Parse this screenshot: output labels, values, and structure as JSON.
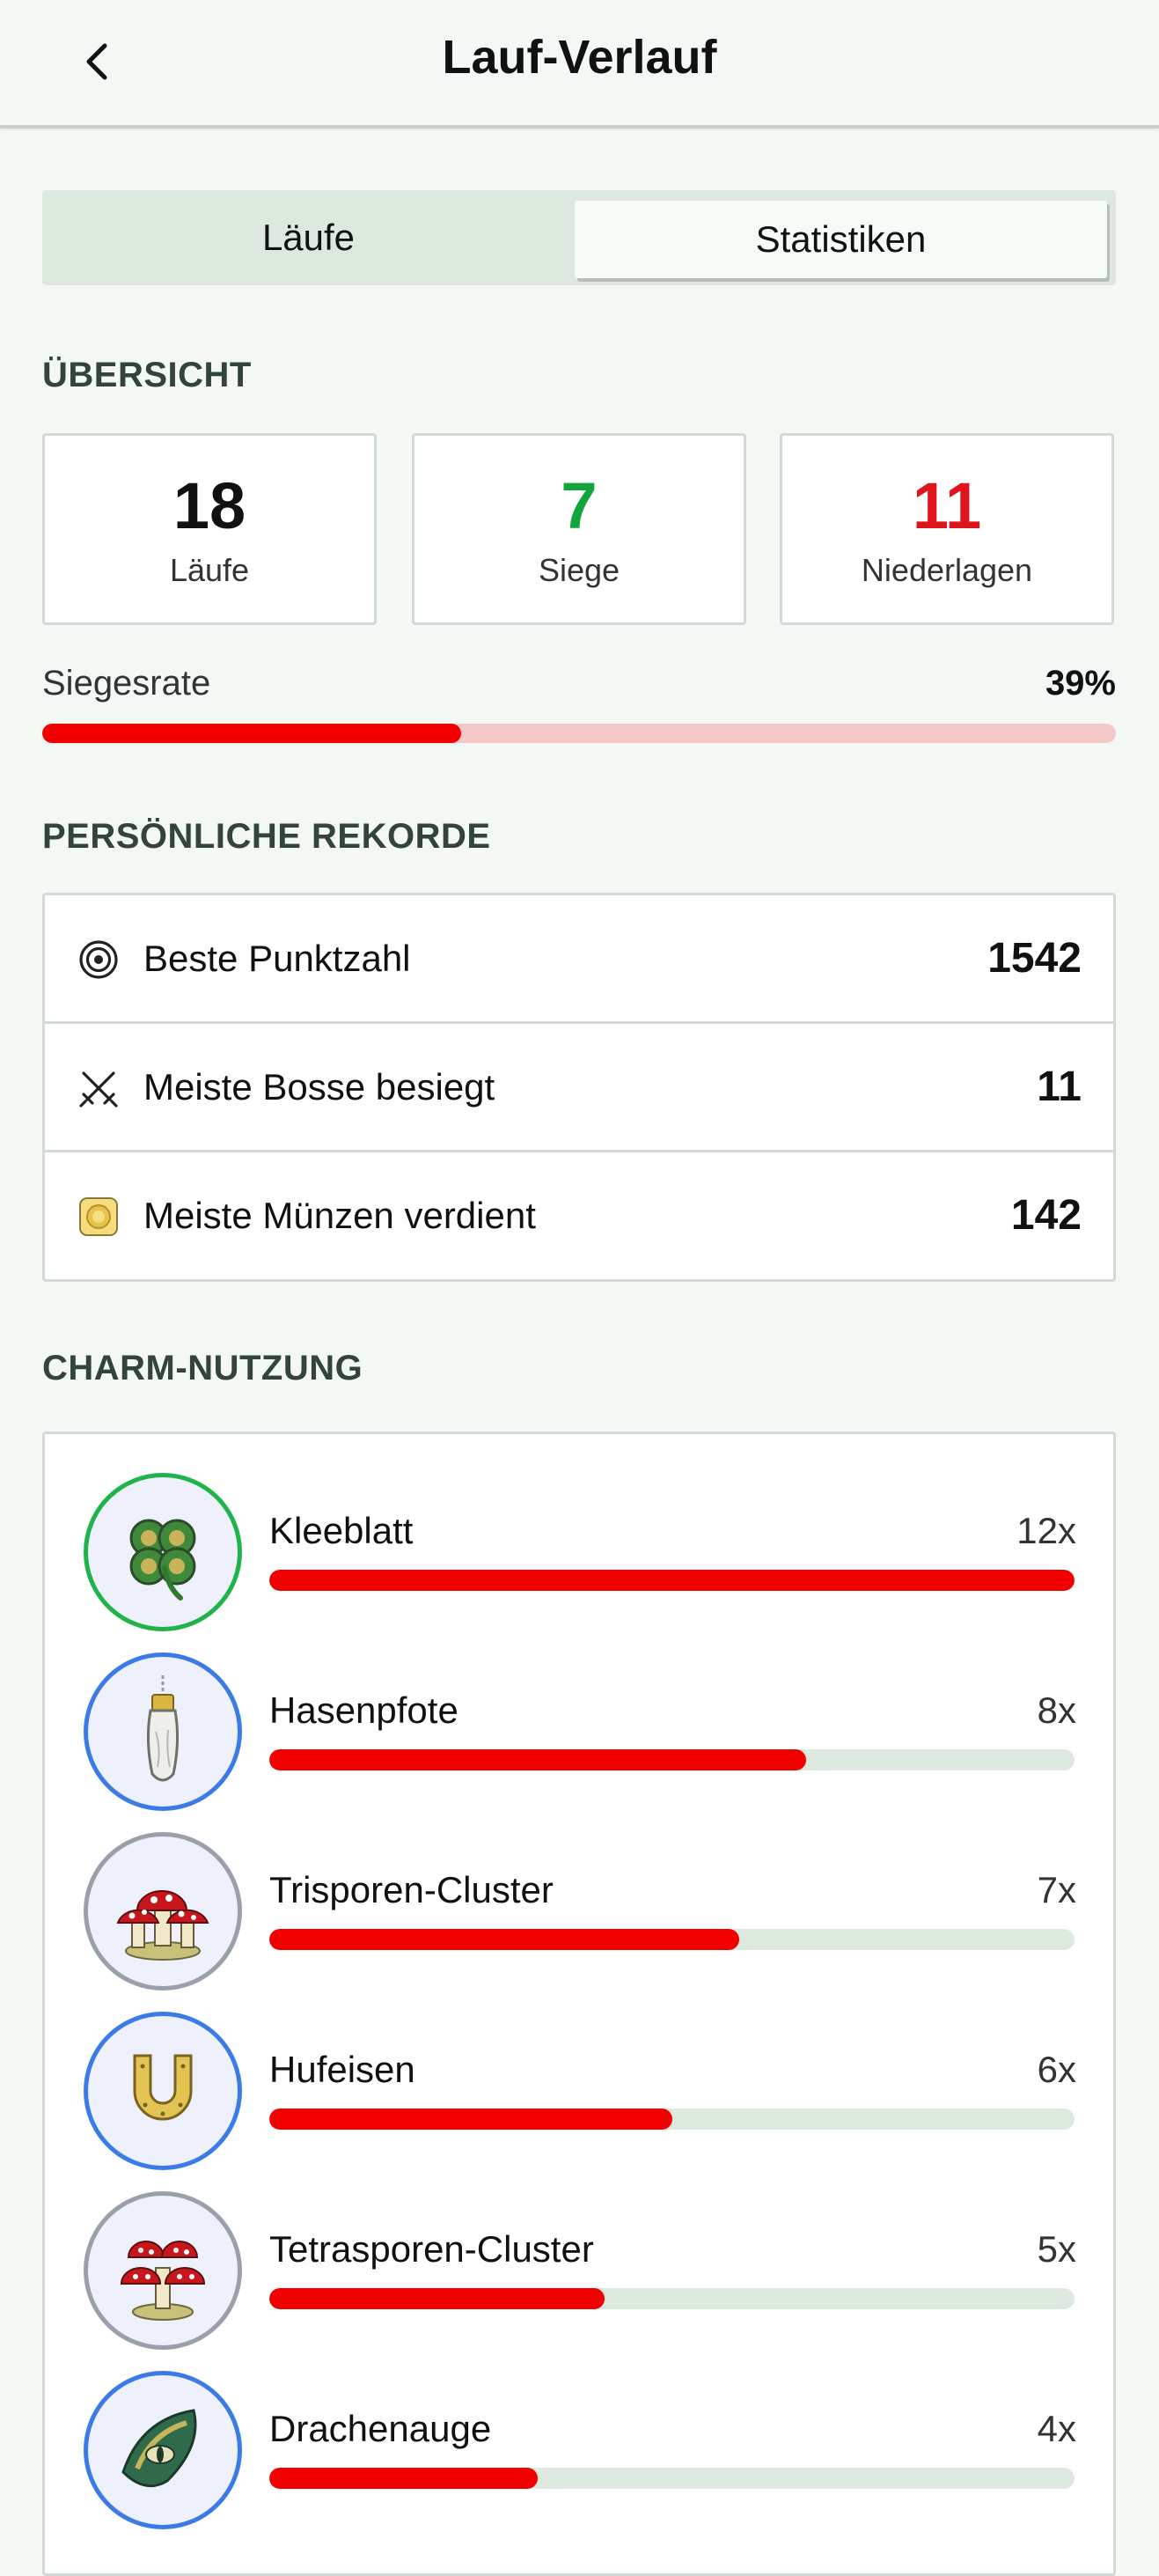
{
  "header": {
    "title": "Lauf-Verlauf",
    "back_icon": "chevron-left-icon"
  },
  "tabs": [
    {
      "label": "Läufe",
      "active": false
    },
    {
      "label": "Statistiken",
      "active": true
    }
  ],
  "overview": {
    "title": "ÜBERSICHT",
    "stats": [
      {
        "value": "18",
        "label": "Läufe",
        "color": "#111111"
      },
      {
        "value": "7",
        "label": "Siege",
        "color": "#12a53c"
      },
      {
        "value": "11",
        "label": "Niederlagen",
        "color": "#e0141c"
      }
    ],
    "win_rate_label": "Siegesrate",
    "win_rate_text": "39%",
    "win_rate_fraction": 0.39
  },
  "records": {
    "title": "PERSÖNLICHE REKORDE",
    "items": [
      {
        "icon": "target-icon",
        "label": "Beste Punktzahl",
        "value": "1542"
      },
      {
        "icon": "crossed-swords-icon",
        "label": "Meiste Bosse besiegt",
        "value": "11"
      },
      {
        "icon": "coin-icon",
        "label": "Meiste Münzen verdient",
        "value": "142"
      }
    ]
  },
  "charms": {
    "title": "CHARM-NUTZUNG",
    "items": [
      {
        "name": "Kleeblatt",
        "count": "12x",
        "uses": 12,
        "icon": "clover-icon",
        "ring_color": "#1fb34a"
      },
      {
        "name": "Hasenpfote",
        "count": "8x",
        "uses": 8,
        "icon": "rabbit-foot-icon",
        "ring_color": "#3b7be6"
      },
      {
        "name": "Trisporen-Cluster",
        "count": "7x",
        "uses": 7,
        "icon": "mushroom-cluster-icon",
        "ring_color": "#9aa0ab"
      },
      {
        "name": "Hufeisen",
        "count": "6x",
        "uses": 6,
        "icon": "horseshoe-icon",
        "ring_color": "#3b7be6"
      },
      {
        "name": "Tetrasporen-Cluster",
        "count": "5x",
        "uses": 5,
        "icon": "mushroom-cluster-icon",
        "ring_color": "#9aa0ab"
      },
      {
        "name": "Drachenauge",
        "count": "4x",
        "uses": 4,
        "icon": "dragon-eye-icon",
        "ring_color": "#3b7be6"
      }
    ]
  },
  "colors": {
    "accent_red": "#f20000",
    "bar_track": "#dde9df",
    "win_rate_track": "#f4c8c6"
  }
}
